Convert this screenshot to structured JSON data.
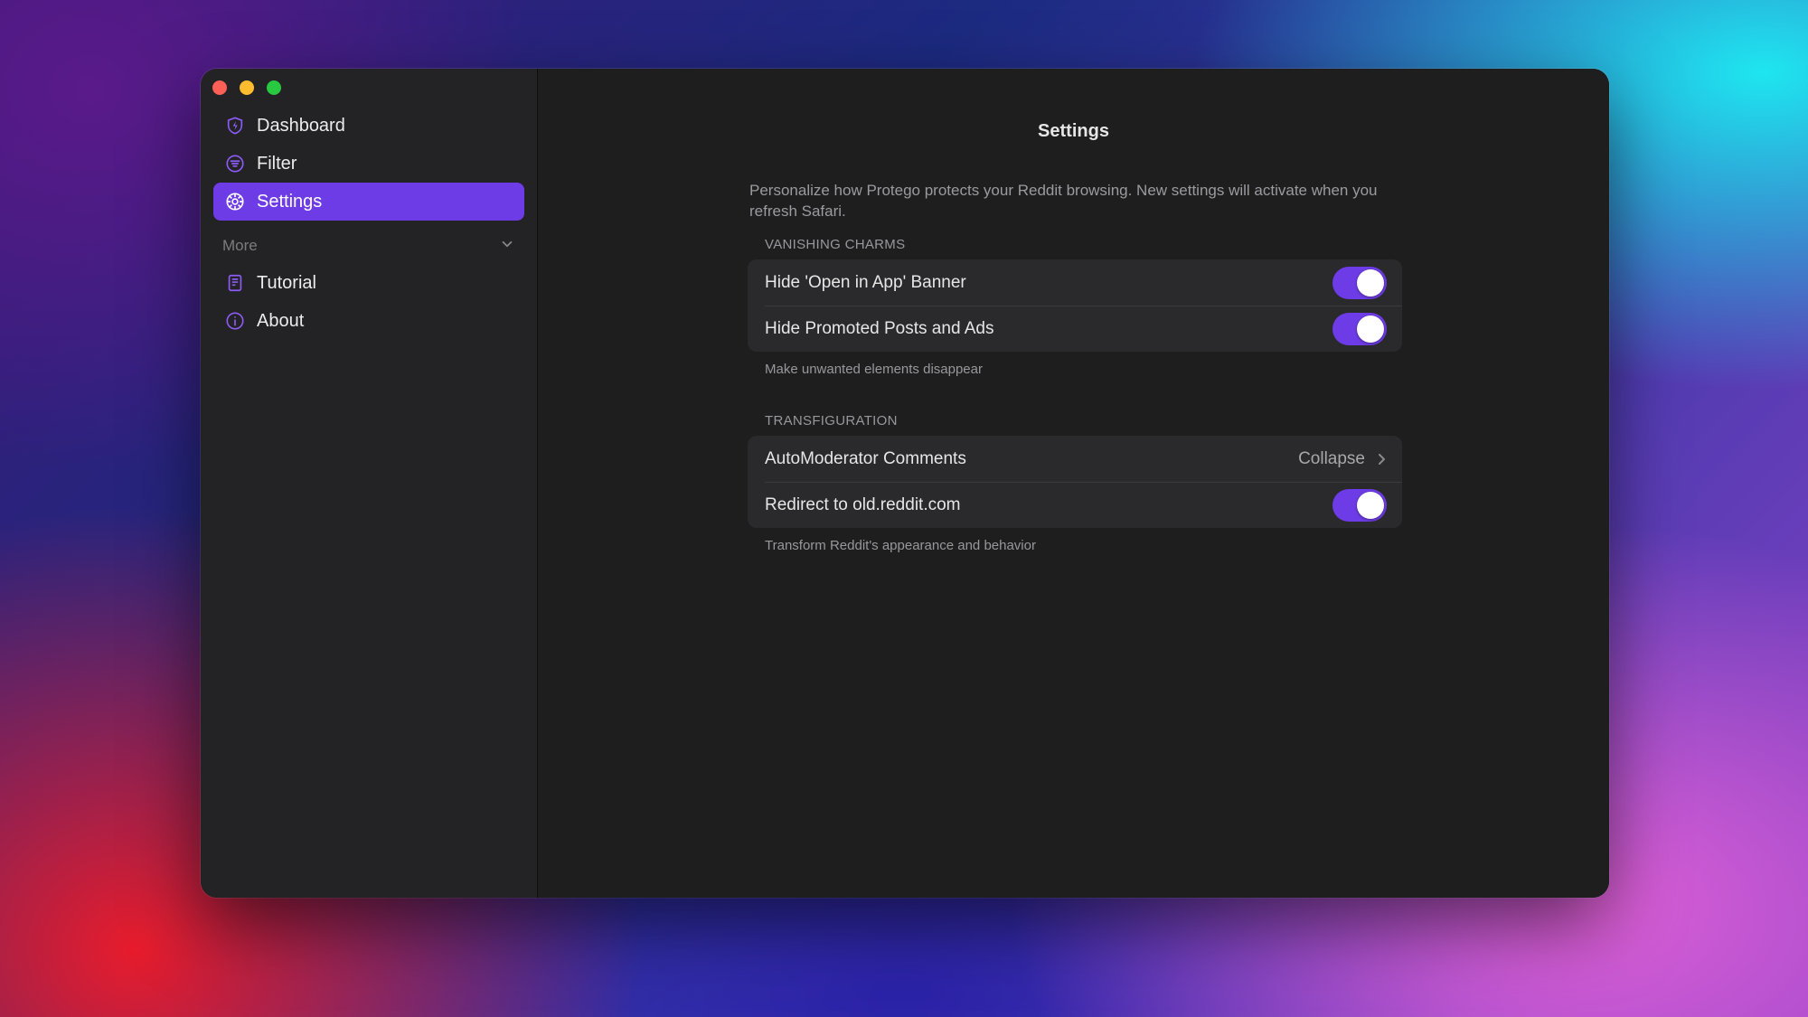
{
  "sidebar": {
    "items": [
      {
        "label": "Dashboard",
        "icon": "shield-bolt-icon"
      },
      {
        "label": "Filter",
        "icon": "filter-lines-icon"
      },
      {
        "label": "Settings",
        "icon": "gear-icon"
      }
    ],
    "more_label": "More",
    "more_items": [
      {
        "label": "Tutorial",
        "icon": "book-icon"
      },
      {
        "label": "About",
        "icon": "info-icon"
      }
    ]
  },
  "main": {
    "title": "Settings",
    "intro": "Personalize how Protego protects your Reddit browsing. New settings will activate when you refresh Safari.",
    "sections": [
      {
        "header": "VANISHING CHARMS",
        "rows": [
          {
            "label": "Hide 'Open in App' Banner",
            "toggle": true
          },
          {
            "label": "Hide Promoted Posts and Ads",
            "toggle": true
          }
        ],
        "footnote": "Make unwanted elements disappear"
      },
      {
        "header": "TRANSFIGURATION",
        "rows": [
          {
            "label": "AutoModerator Comments",
            "value": "Collapse"
          },
          {
            "label": "Redirect to old.reddit.com",
            "toggle": true
          }
        ],
        "footnote": "Transform Reddit's appearance and behavior"
      }
    ]
  },
  "colors": {
    "accent": "#6e3ce6"
  }
}
